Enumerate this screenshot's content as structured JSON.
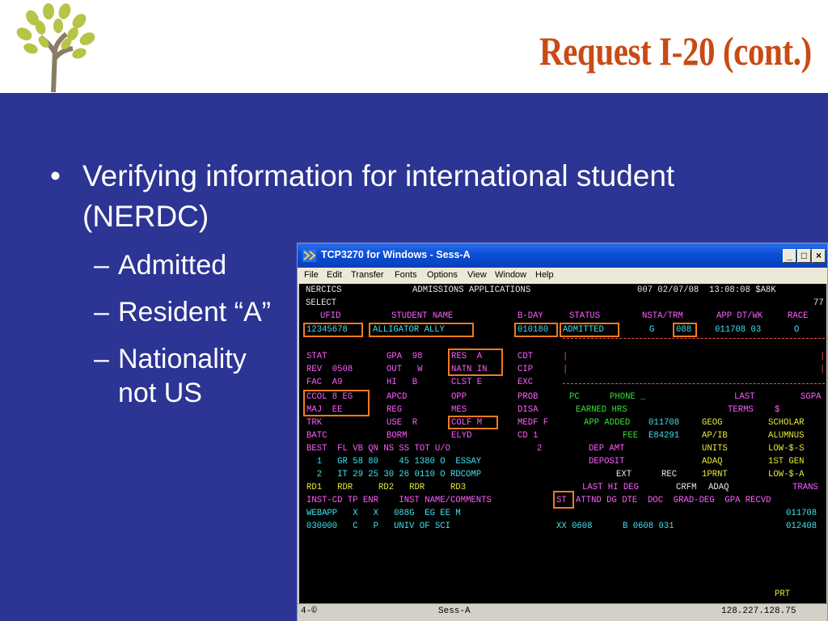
{
  "slide": {
    "title": "Request I-20 (cont.)",
    "bullet": "Verifying information for international student (NERDC)",
    "subbullets": [
      "Admitted",
      "Resident “A”",
      "Nationality not US"
    ]
  },
  "window": {
    "title": "TCP3270 for Windows - Sess-A",
    "menu": [
      "File",
      "Edit",
      "Transfer",
      "Fonts",
      "Options",
      "View",
      "Window",
      "Help"
    ],
    "buttons": {
      "minimize": "_",
      "maximize": "□",
      "close": "×"
    }
  },
  "terminal": {
    "r1a": "NERCICS",
    "r1b": "ADMISSIONS APPLICATIONS",
    "r1c": "007 02/07/08  13:08:08 $A8K",
    "r2a": "SELECT",
    "r2b": "77",
    "hdr_ufid": "UFID",
    "hdr_name": "STUDENT NAME",
    "hdr_bday": "B-DAY",
    "hdr_status": "STATUS",
    "hdr_nsta": "NSTA/TRM",
    "hdr_app": "APP DT/WK",
    "hdr_race": "RACE",
    "ufid": "12345678",
    "name": "ALLIGATOR ALLY",
    "bday": "010180",
    "status": "ADMITTED",
    "nsta_g": "G",
    "trm": "088",
    "appdt": "011708 03",
    "race": "O",
    "r5a": "STAT",
    "r5b": "GPA  98",
    "r5c": "RES  A",
    "r5d": "CDT",
    "r5e": "|",
    "r5f": "|",
    "r6a": "REV  0508",
    "r6b": "OUT   W",
    "r6c": "NATN IN",
    "r6d": "CIP",
    "r6e": "|",
    "r6f": "|",
    "r7a": "FAC  A9",
    "r7b": "HI   B",
    "r7c": "CLST E",
    "r7d": "EXC",
    "r8a": "CCOL 8 EG",
    "r8b": "APCD",
    "r8c": "OPP",
    "r8d": "PROB",
    "r8e": "PC",
    "r8f": "PHONE _",
    "r8g": "LAST",
    "r8h": "SGPA",
    "r9a": "MAJ  EE",
    "r9b": "REG",
    "r9c": "MES",
    "r9d": "DISA",
    "r9e": "EARNED HRS",
    "r9f": "TERMS",
    "r9g": "$",
    "r10a": "TRK",
    "r10b": "USE  R",
    "r10c": "COLF M",
    "r10d": "MEDF F",
    "r10e": "APP ADDED",
    "r10f": "011708",
    "r10g": "GEOG",
    "r10h": "SCHOLAR",
    "r11a": "BATC",
    "r11b": "BORM",
    "r11c": "ELYD",
    "r11d": "CD 1",
    "r11e": "FEE",
    "r11f": "E84291",
    "r11g": "AP/IB",
    "r11h": "ALUMNUS",
    "r12a": "BEST  FL VB QN NS SS TOT U/O",
    "r12b": "2",
    "r12c": "DEP AMT",
    "r12d": "UNITS",
    "r12e": "LOW-$-S",
    "r13a": "  1   GR 58 80    45 1380 O  ESSAY",
    "r13b": "DEPOSIT",
    "r13c": "ADAQ",
    "r13d": "1ST GEN",
    "r14a": "  2   IT 29 25 30 26 0110 O RDCOMP",
    "r14b": "EXT",
    "r14c": "REC",
    "r14d": "1PRNT",
    "r14e": "LOW-$-A",
    "r15a": "RD1   RDR     RD2   RDR     RD3",
    "r15b": "LAST HI DEG",
    "r15c": "CRFM",
    "r15d": "ADAQ",
    "r15e": "TRANS",
    "r16a": "INST-CD TP ENR    INST NAME/COMMENTS",
    "r16b": "ST",
    "r16c": "ATTND DG DTE  DOC  GRAD-DEG  GPA RECVD",
    "r17a": "WEBAPP   X   X   088G  EG EE M",
    "r17b": "011708",
    "r18a": "030000   C   P   UNIV OF SCI",
    "r18b": "XX 0608",
    "r18c": "B 0608 031",
    "r18d": "012408",
    "prt": "PRT"
  },
  "statusbar": {
    "left": "4-©",
    "session": "Sess-A",
    "ip": "128.227.128.75"
  },
  "colors": {
    "title": "#c84b14",
    "slide_bg": "#2c3494",
    "highlight": "#f07b1e"
  }
}
